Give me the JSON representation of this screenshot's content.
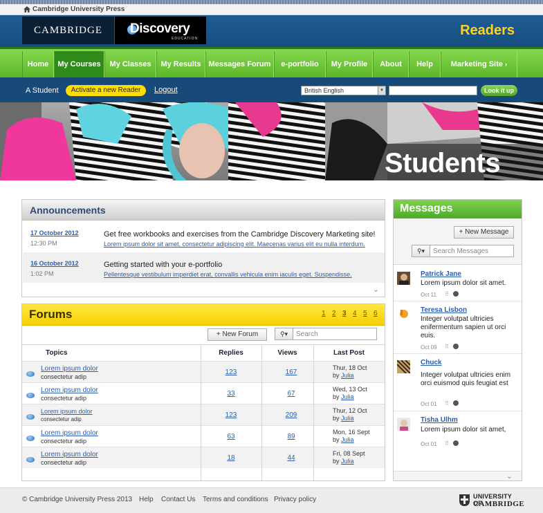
{
  "press": {
    "label": "Cambridge University Press"
  },
  "brand": {
    "cambridge_logo": "CAMBRIDGE",
    "discovery_logo": "Discovery",
    "discovery_sub": "EDUCATION",
    "readers_title": "Readers"
  },
  "nav": [
    {
      "label": "Home"
    },
    {
      "label": "My Courses"
    },
    {
      "label": "My Classes"
    },
    {
      "label": "My Results"
    },
    {
      "label": "Messages Forum"
    },
    {
      "label": "e-portfolio"
    },
    {
      "label": "My Profile"
    },
    {
      "label": "About"
    },
    {
      "label": "Help"
    },
    {
      "label": "Marketing Site"
    }
  ],
  "userbar": {
    "user": "A Student",
    "activate": "Activate a new Reader",
    "logout": "Logout",
    "language": "British English",
    "lookup": "Look it up"
  },
  "hero": {
    "title": "Students"
  },
  "announcements": {
    "title": "Announcements",
    "items": [
      {
        "date": "17 October 2012",
        "time": "12:30 PM",
        "title": "Get free workbooks and exercises from the Cambridge Discovery Marketing site!",
        "summary": "Lorem ipsum dolor sit amet, consectetur adipiscing elit. Maecenas varius elit eu nulla interdum."
      },
      {
        "date": "16 October 2012",
        "time": "1:02 PM",
        "title": "Getting started with your e-portfolio",
        "summary": "Pellentesque vestibulum imperdiet erat, convallis vehicula enim iaculis eget. Suspendisse."
      }
    ]
  },
  "forums": {
    "title": "Forums",
    "pages": [
      "1",
      "2",
      "3",
      "4",
      "5",
      "6"
    ],
    "new_forum": "New Forum",
    "search_placeholder": "Search",
    "columns": {
      "topics": "Topics",
      "replies": "Replies",
      "views": "Views",
      "last_post": "Last Post"
    },
    "rows": [
      {
        "title": "Lorem ipsum dolor",
        "sub": "consectetur adip",
        "replies": "123",
        "views": "167",
        "date": "Thur, 18 Oct",
        "by": "by",
        "author": "Julia"
      },
      {
        "title": "Lorem ipsum dolor",
        "sub": "consectetur adip",
        "replies": "33",
        "views": "67",
        "date": "Wed, 13 Oct",
        "by": "by",
        "author": "Julia"
      },
      {
        "title": "Lorem ipsum dolor",
        "sub": "consectetur adip",
        "replies": "123",
        "views": "209",
        "date": "Thur, 12 Oct",
        "by": "by",
        "author": "Julia"
      },
      {
        "title": "Lorem ipsum dolor",
        "sub": "consectetur adip",
        "replies": "63",
        "views": "89",
        "date": "Mon, 16 Sept",
        "by": "by",
        "author": "Julia"
      },
      {
        "title": "Lorem ipsum dolor",
        "sub": "consectetur adip",
        "replies": "18",
        "views": "44",
        "date": "Fri, 08 Sept",
        "by": "by",
        "author": "Julia"
      }
    ]
  },
  "messages": {
    "title": "Messages",
    "new_message": "New Message",
    "search_placeholder": "Search Messages",
    "items": [
      {
        "name": "Patrick Jane",
        "text": "Lorem ipsum dolor sit amet.",
        "date": "Oct 11"
      },
      {
        "name": "Teresa Lisbon",
        "text": "Integer volutpat ultricies enifermentum sapien ut orci euis.",
        "date": "Oct 09"
      },
      {
        "name": "Chuck",
        "text": "Integer volutpat ultricies enim orci euismod quis feugiat est",
        "date": "Oct 01"
      },
      {
        "name": "Tisha Ulhm",
        "text": "Lorem ipsum dolor sit amet,",
        "date": "Oct 01"
      }
    ]
  },
  "footer": {
    "copyright": "© Cambridge University Press 2013",
    "links": [
      "Help",
      "Contact Us",
      "Terms and conditions",
      "Privacy policy"
    ],
    "university": "UNIVERSITY OF",
    "cambridge": "CAMBRIDGE"
  }
}
